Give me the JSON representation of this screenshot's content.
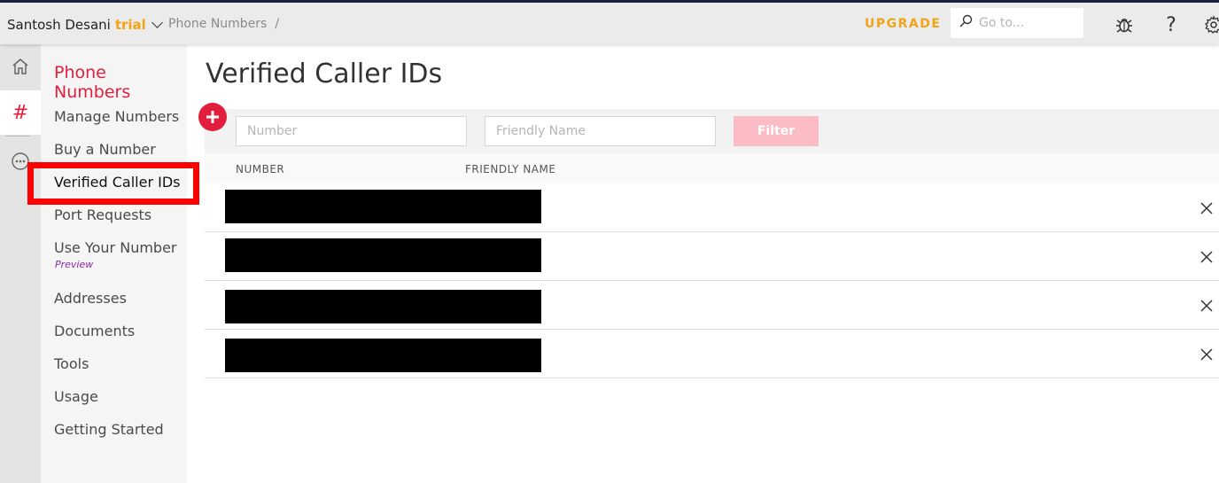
{
  "account": {
    "name": "Santosh Desani",
    "plan": "trial"
  },
  "breadcrumb": {
    "section": "Phone Numbers",
    "separator": "/"
  },
  "header": {
    "upgrade_label": "UPGRADE",
    "search_placeholder": "Go to...",
    "help_label": "?"
  },
  "subnav": {
    "title": "Phone Numbers",
    "items": [
      {
        "label": "Manage Numbers"
      },
      {
        "label": "Buy a Number"
      },
      {
        "label": "Verified Caller IDs"
      },
      {
        "label": "Port Requests"
      },
      {
        "label": "Use Your Number",
        "badge": "Preview"
      },
      {
        "label": "Addresses"
      },
      {
        "label": "Documents"
      },
      {
        "label": "Tools"
      },
      {
        "label": "Usage"
      },
      {
        "label": "Getting Started"
      }
    ]
  },
  "rail": {
    "hash_label": "#"
  },
  "main": {
    "title": "Verified Caller IDs",
    "filter": {
      "number_placeholder": "Number",
      "friendly_placeholder": "Friendly Name",
      "button_label": "Filter"
    },
    "columns": [
      "NUMBER",
      "FRIENDLY NAME"
    ],
    "rows": [
      {
        "number": "",
        "friendly_name": "",
        "redacted": true
      },
      {
        "number": "",
        "friendly_name": "",
        "redacted": true
      },
      {
        "number": "",
        "friendly_name": "",
        "redacted": true
      },
      {
        "number": "",
        "friendly_name": "",
        "redacted": true
      }
    ]
  },
  "colors": {
    "brand_red": "#e31e3c",
    "upgrade_orange": "#f2a316",
    "filter_button": "#fcbcc6",
    "highlight": "#ff0000"
  }
}
